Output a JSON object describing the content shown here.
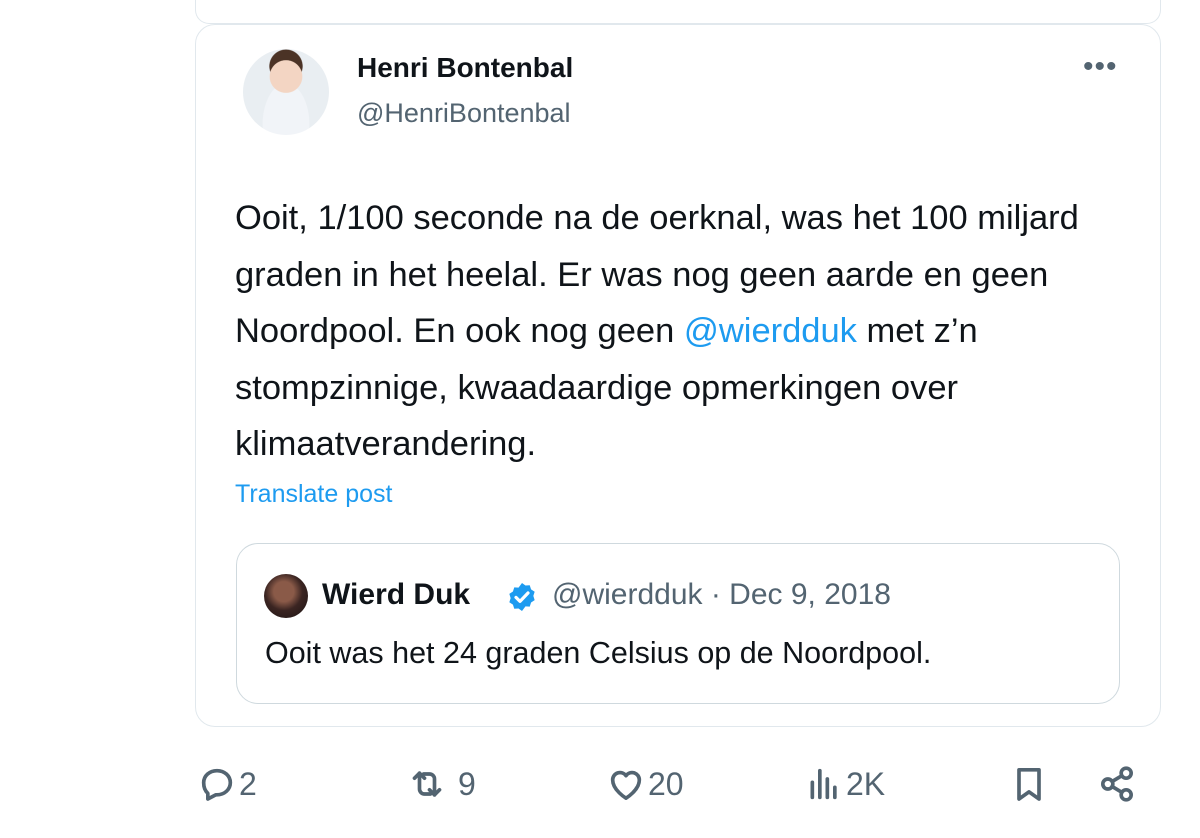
{
  "tweet": {
    "author_name": "Henri Bontenbal",
    "author_handle": "@HenriBontenbal",
    "more_label": "•••",
    "text_before": "Ooit, 1/100 seconde na de oerknal, was het 100 miljard graden in het heelal. Er was nog geen aarde en geen Noordpool. En ook nog geen ",
    "mention": "@wierdduk",
    "text_after": " met z’n stompzinnige, kwaadaardige opmerkingen over klimaatverandering.",
    "translate_label": "Translate post"
  },
  "quoted": {
    "author_name": "Wierd Duk",
    "meta": "@wierdduk · Dec 9, 2018",
    "text": "Ooit was het 24 graden Celsius op de Noordpool."
  },
  "actions": {
    "replies": "2",
    "reposts": "9",
    "likes": "20",
    "views": "2K"
  },
  "colors": {
    "accent": "#1d9bf0",
    "text": "#0f1419",
    "muted": "#536471",
    "border": "#e1e8ed"
  },
  "icons": [
    "reply-icon",
    "repost-icon",
    "like-icon",
    "views-icon",
    "bookmark-icon",
    "share-icon",
    "verified-badge-icon",
    "more-icon"
  ]
}
